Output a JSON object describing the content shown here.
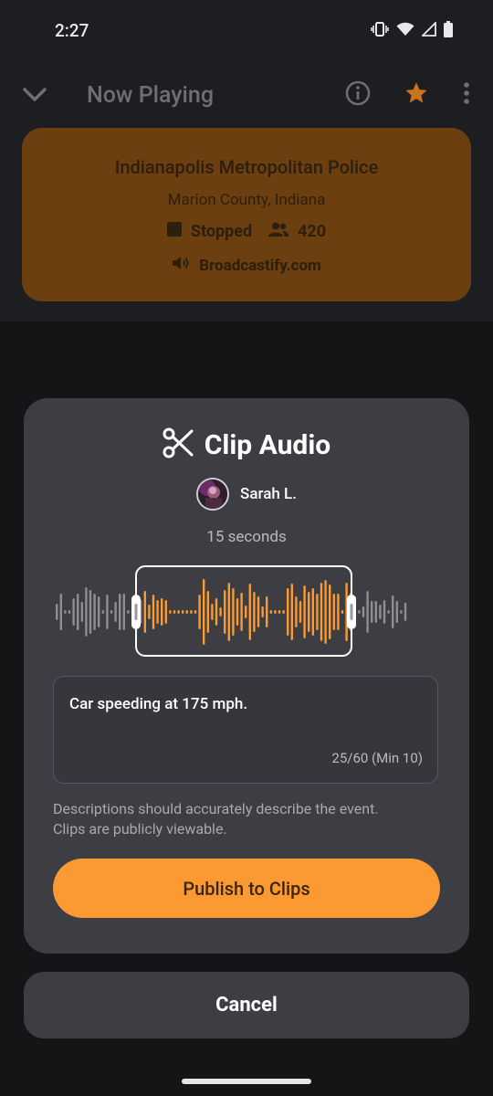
{
  "status_bar": {
    "time": "2:27",
    "icons": [
      "vibrate-icon",
      "wifi-icon",
      "cell-signal-icon",
      "battery-icon"
    ]
  },
  "header": {
    "title": "Now Playing",
    "icons": [
      "chevron-down-icon",
      "info-icon",
      "star-icon",
      "more-vert-icon"
    ]
  },
  "station": {
    "name": "Indianapolis Metropolitan Police",
    "location": "Marion County, Indiana",
    "status": "Stopped",
    "listeners": "420",
    "source": "Broadcastify.com"
  },
  "clip": {
    "title": "Clip Audio",
    "user_name": "Sarah L.",
    "duration": "15 seconds",
    "description_value": "Car speeding at 175 mph.",
    "char_count": "25/60 (Min 10)",
    "hint_line1": "Descriptions should accurately describe the event.",
    "hint_line2": "Clips are publicly viewable.",
    "publish_label": "Publish to Clips",
    "cancel_label": "Cancel"
  },
  "colors": {
    "accent": "#fb9a32",
    "card_bg": "#6b3f0f",
    "star": "#c8741e",
    "sheet_bg": "#3c3e44",
    "waveform_inactive": "#8e8f93"
  }
}
